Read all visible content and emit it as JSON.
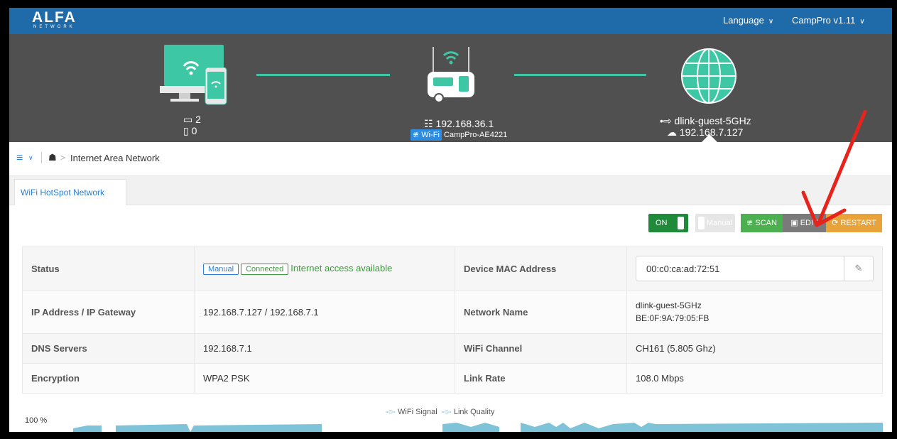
{
  "topbar": {
    "logo_text": "ALFA",
    "logo_sub": "NETWORK",
    "language_label": "Language",
    "version_label": "CampPro v1.11"
  },
  "hero": {
    "clients": {
      "computers": "2",
      "phones": "0"
    },
    "router": {
      "ip": "192.168.36.1",
      "wifi_badge": "Wi-Fi",
      "ssid": "CampPro-AE4221"
    },
    "internet": {
      "network": "dlink-guest-5GHz",
      "ip": "192.168.7.127"
    }
  },
  "breadcrumb": {
    "page": "Internet Area Network"
  },
  "tabs": [
    {
      "label": "WiFi HotSpot Network"
    }
  ],
  "actions": {
    "on_label": "ON",
    "manual_label": "Manual",
    "scan_label": "SCAN",
    "edit_label": "EDIT",
    "restart_label": "RESTART"
  },
  "info": {
    "status_label": "Status",
    "status_tag_manual": "Manual",
    "status_tag_connected": "Connected",
    "status_text": "Internet access available",
    "mac_label": "Device MAC Address",
    "mac_value": "00:c0:ca:ad:72:51",
    "ip_label": "IP Address / IP Gateway",
    "ip_value": "192.168.7.127 / 192.168.7.1",
    "netname_label": "Network Name",
    "netname_value": "dlink-guest-5GHz",
    "bssid_value": "BE:0F:9A:79:05:FB",
    "dns_label": "DNS Servers",
    "dns_value": "192.168.7.1",
    "channel_label": "WiFi Channel",
    "channel_value": "CH161 (5.805 Ghz)",
    "enc_label": "Encryption",
    "enc_value": "WPA2 PSK",
    "rate_label": "Link Rate",
    "rate_value": "108.0 Mbps"
  },
  "chart": {
    "legend_signal": "WiFi Signal",
    "legend_quality": "Link Quality",
    "y_tick": "100 %"
  },
  "colors": {
    "topbar": "#1f6aa8",
    "hero": "#505050",
    "link": "#3ec7a5",
    "on_green": "#1e8a3a",
    "scan_green": "#4caf50",
    "restart_orange": "#e8a33a",
    "connected_green": "#3a9a3a",
    "manual_blue": "#2a7fd3",
    "annotation_arrow": "#e8231b"
  }
}
